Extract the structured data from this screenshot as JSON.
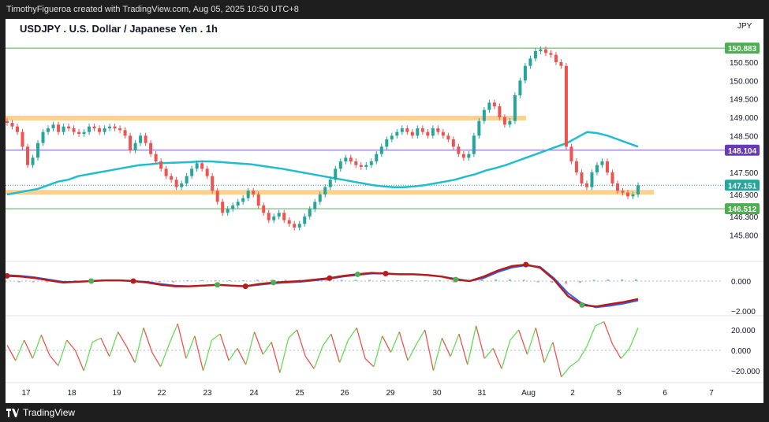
{
  "header": {
    "attribution": "TimothyFigueroa created with TradingView.com, Aug 05, 2025 10:50 UTC+8"
  },
  "footer": {
    "brand": "TradingView"
  },
  "chart_data": {
    "type": "candlestick",
    "title": "USDJPY . U.S. Dollar / Japanese Yen . 1h",
    "currency": "JPY",
    "price_axis": {
      "ticks": [
        "150.500",
        "150.000",
        "149.500",
        "149.000",
        "148.500",
        "147.500",
        "146.900",
        "146.300",
        "145.800"
      ],
      "tick_values": [
        150.5,
        150.0,
        149.5,
        149.0,
        148.5,
        147.5,
        146.9,
        146.3,
        145.8
      ]
    },
    "x_axis": {
      "labels": [
        "17",
        "18",
        "19",
        "22",
        "23",
        "24",
        "25",
        "26",
        "29",
        "30",
        "31",
        "Aug",
        "2",
        "5",
        "6",
        "7"
      ]
    },
    "price_labels": [
      {
        "value": "150.883",
        "color": "#4caf50"
      },
      {
        "value": "148.104",
        "color": "#673ab7"
      },
      {
        "value": "147.151",
        "color": "#26a69a"
      },
      {
        "value": "146.512",
        "color": "#4caf50"
      }
    ],
    "horizontal_lines": [
      {
        "value": 150.883,
        "color": "#4caf50",
        "kind": "line"
      },
      {
        "value": 148.104,
        "color": "#7e57c2",
        "kind": "line"
      },
      {
        "value": 146.512,
        "color": "#4caf50",
        "kind": "line"
      },
      {
        "value": 148.98,
        "color": "#ffcc80",
        "kind": "zone"
      },
      {
        "value": 146.96,
        "color": "#ffcc80",
        "kind": "zone"
      }
    ],
    "colors": {
      "up": "#26a69a",
      "down": "#ef5350",
      "moving_average": "#1fbcd2",
      "macd_fast": "#4caf50",
      "macd_slow": "#b71c1c",
      "macd_signal": "#2962ff",
      "oscillator_up": "#66dd55",
      "oscillator_down": "#ef5350"
    },
    "close_series": [
      148.85,
      148.75,
      148.6,
      148.2,
      147.7,
      147.9,
      148.3,
      148.6,
      148.7,
      148.8,
      148.6,
      148.75,
      148.7,
      148.6,
      148.55,
      148.6,
      148.75,
      148.7,
      148.6,
      148.7,
      148.75,
      148.7,
      148.65,
      148.5,
      148.1,
      148.3,
      148.5,
      148.3,
      148.0,
      147.8,
      147.6,
      147.4,
      147.3,
      147.1,
      147.2,
      147.4,
      147.6,
      147.75,
      147.6,
      147.4,
      147.0,
      146.7,
      146.4,
      146.5,
      146.6,
      146.7,
      146.8,
      147.0,
      146.9,
      146.6,
      146.4,
      146.2,
      146.3,
      146.4,
      146.2,
      146.1,
      146.0,
      146.1,
      146.3,
      146.5,
      146.7,
      146.9,
      147.1,
      147.3,
      147.6,
      147.8,
      147.9,
      147.8,
      147.7,
      147.65,
      147.7,
      147.8,
      148.0,
      148.2,
      148.4,
      148.5,
      148.6,
      148.7,
      148.6,
      148.5,
      148.7,
      148.6,
      148.5,
      148.7,
      148.6,
      148.5,
      148.4,
      148.2,
      148.0,
      147.9,
      148.0,
      148.5,
      148.9,
      149.2,
      149.4,
      149.3,
      149.0,
      148.8,
      148.9,
      149.6,
      150.0,
      150.4,
      150.6,
      150.8,
      150.85,
      150.75,
      150.7,
      150.5,
      150.4,
      148.2,
      147.8,
      147.5,
      147.2,
      147.1,
      147.5,
      147.7,
      147.8,
      147.5,
      147.2,
      147.0,
      146.95,
      146.85,
      146.9,
      147.15
    ],
    "ma_series": [
      146.9,
      146.95,
      147.0,
      147.05,
      147.15,
      147.25,
      147.3,
      147.4,
      147.45,
      147.5,
      147.55,
      147.6,
      147.65,
      147.7,
      147.72,
      147.75,
      147.76,
      147.77,
      147.78,
      147.8,
      147.8,
      147.78,
      147.76,
      147.74,
      147.72,
      147.68,
      147.64,
      147.6,
      147.55,
      147.5,
      147.45,
      147.4,
      147.35,
      147.3,
      147.25,
      147.2,
      147.15,
      147.12,
      147.1,
      147.1,
      147.12,
      147.15,
      147.2,
      147.25,
      147.3,
      147.38,
      147.45,
      147.55,
      147.62,
      147.7,
      147.8,
      147.9,
      148.0,
      148.1,
      148.2,
      148.3,
      148.45,
      148.6,
      148.57,
      148.5,
      148.4,
      148.3,
      148.2
    ],
    "macd_fast_series": [
      0.35,
      0.3,
      0.2,
      0.05,
      -0.1,
      -0.05,
      0.0,
      0.05,
      0.05,
      0.0,
      -0.1,
      -0.25,
      -0.35,
      -0.35,
      -0.3,
      -0.25,
      -0.3,
      -0.35,
      -0.2,
      -0.1,
      -0.05,
      0.0,
      0.1,
      0.2,
      0.35,
      0.45,
      0.55,
      0.5,
      0.45,
      0.45,
      0.4,
      0.3,
      0.1,
      0.0,
      0.3,
      0.7,
      1.0,
      1.1,
      0.9,
      0.1,
      -1.0,
      -1.6,
      -1.7,
      -1.55,
      -1.4,
      -1.2
    ],
    "macd_slow_series": [
      0.4,
      0.35,
      0.25,
      0.1,
      -0.05,
      -0.05,
      0.0,
      0.05,
      0.05,
      0.0,
      -0.05,
      -0.2,
      -0.3,
      -0.35,
      -0.3,
      -0.25,
      -0.3,
      -0.35,
      -0.25,
      -0.15,
      -0.1,
      -0.05,
      0.05,
      0.15,
      0.3,
      0.4,
      0.5,
      0.5,
      0.45,
      0.45,
      0.4,
      0.3,
      0.15,
      0.0,
      0.2,
      0.6,
      0.9,
      1.05,
      0.95,
      0.2,
      -0.8,
      -1.5,
      -1.75,
      -1.65,
      -1.5,
      -1.3
    ],
    "macd_axis": {
      "ticks": [
        "0.000",
        "−2.000"
      ],
      "tick_values": [
        0,
        -2
      ]
    },
    "oscillator_series": [
      5,
      -10,
      10,
      -8,
      15,
      -5,
      -15,
      10,
      0,
      -20,
      8,
      12,
      -6,
      18,
      4,
      -12,
      22,
      -2,
      -16,
      6,
      26,
      -8,
      14,
      -20,
      10,
      16,
      -10,
      2,
      -14,
      18,
      -4,
      8,
      -22,
      12,
      20,
      -6,
      -18,
      4,
      16,
      -12,
      10,
      22,
      -8,
      -16,
      14,
      -2,
      18,
      -10,
      6,
      20,
      -20,
      12,
      -6,
      16,
      -14,
      24,
      -8,
      2,
      -18,
      10,
      20,
      -4,
      22,
      -12,
      8,
      -26,
      -16,
      -10,
      4,
      24,
      28,
      6,
      -8,
      2,
      22
    ],
    "oscillator_axis": {
      "ticks": [
        "20.000",
        "0.000",
        "−20.000"
      ],
      "tick_values": [
        20,
        0,
        -20
      ]
    }
  }
}
